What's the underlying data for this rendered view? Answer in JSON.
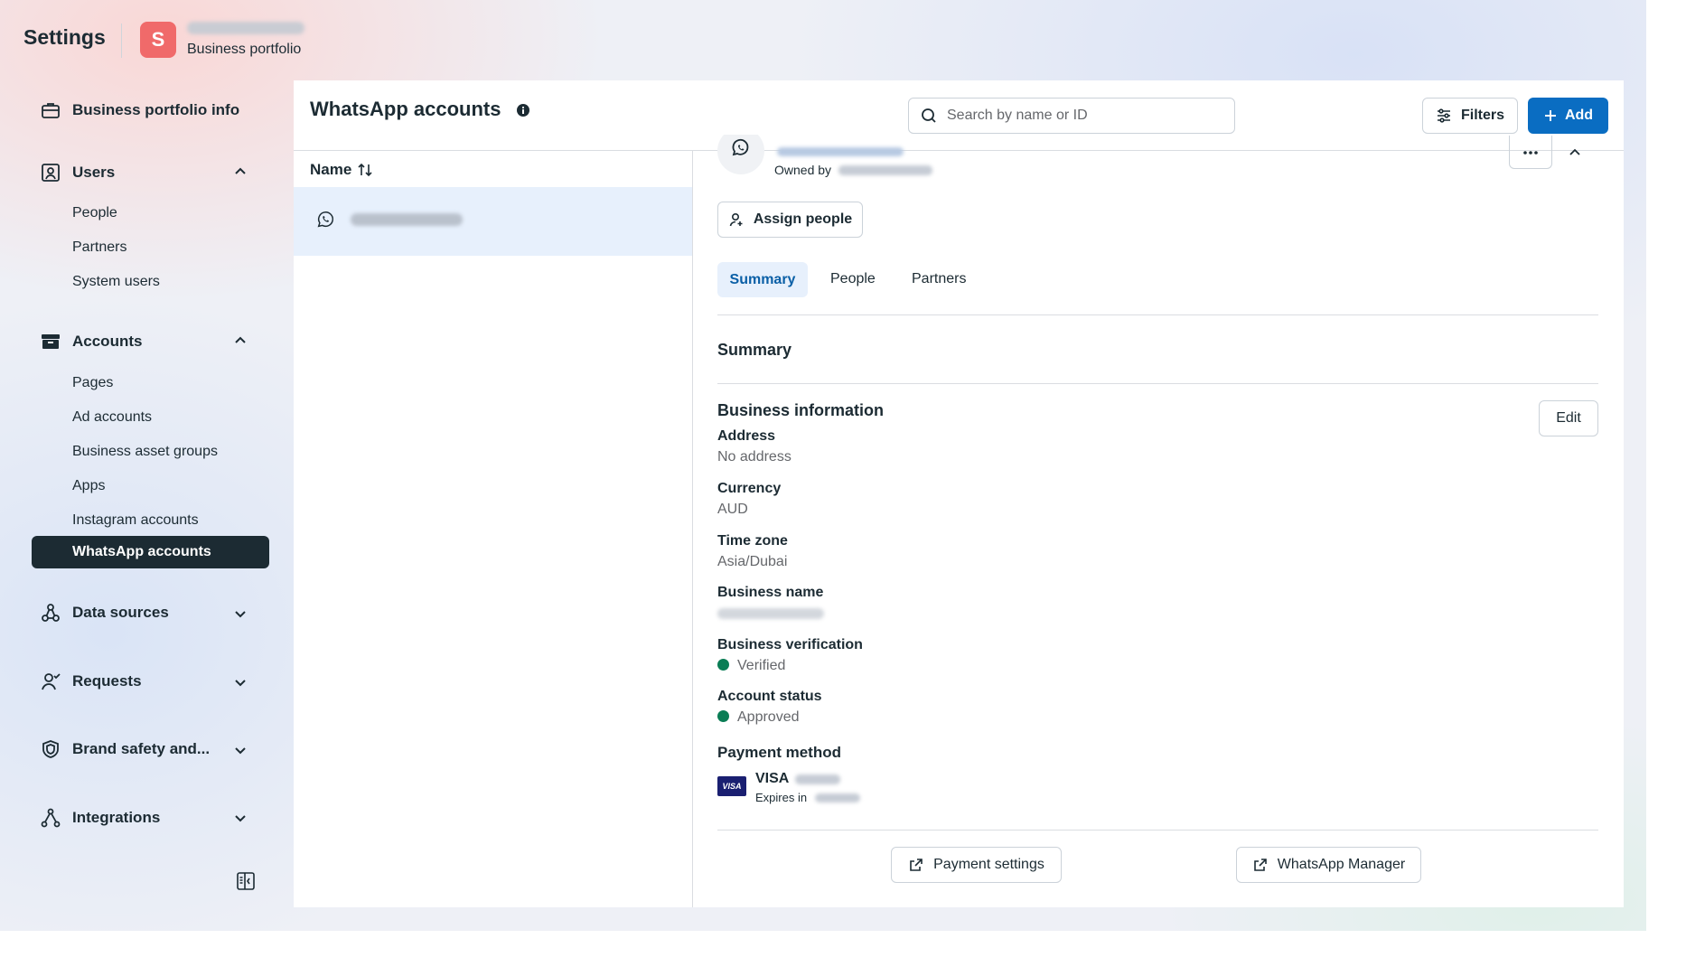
{
  "header": {
    "title": "Settings",
    "avatar_letter": "S",
    "portfolio_label": "Business portfolio"
  },
  "sidebar": {
    "business_info": "Business portfolio info",
    "users": {
      "label": "Users",
      "items": [
        "People",
        "Partners",
        "System users"
      ]
    },
    "accounts": {
      "label": "Accounts",
      "items": [
        "Pages",
        "Ad accounts",
        "Business asset groups",
        "Apps",
        "Instagram accounts"
      ],
      "active": "WhatsApp accounts"
    },
    "data_sources": "Data sources",
    "requests": "Requests",
    "brand_safety": "Brand safety and...",
    "integrations": "Integrations"
  },
  "main": {
    "title": "WhatsApp accounts",
    "search_placeholder": "Search by name or ID",
    "filters_label": "Filters",
    "add_label": "Add",
    "column_name": "Name"
  },
  "detail": {
    "owned_by": "Owned by",
    "assign_people": "Assign people",
    "tabs": [
      "Summary",
      "People",
      "Partners"
    ],
    "active_tab": "Summary",
    "summary_title": "Summary",
    "business_info_title": "Business information",
    "edit_label": "Edit",
    "address_label": "Address",
    "address_value": "No address",
    "currency_label": "Currency",
    "currency_value": "AUD",
    "timezone_label": "Time zone",
    "timezone_value": "Asia/Dubai",
    "business_name_label": "Business name",
    "verification_label": "Business verification",
    "verification_value": "Verified",
    "account_status_label": "Account status",
    "account_status_value": "Approved",
    "payment_label": "Payment method",
    "card_brand": "VISA",
    "card_badge": "VISA",
    "expires_label": "Expires in",
    "payment_settings": "Payment settings",
    "whatsapp_manager": "WhatsApp Manager"
  },
  "colors": {
    "accent": "#0a6dc2",
    "active_nav": "#1c2b33",
    "status_green": "#0a7d55"
  }
}
